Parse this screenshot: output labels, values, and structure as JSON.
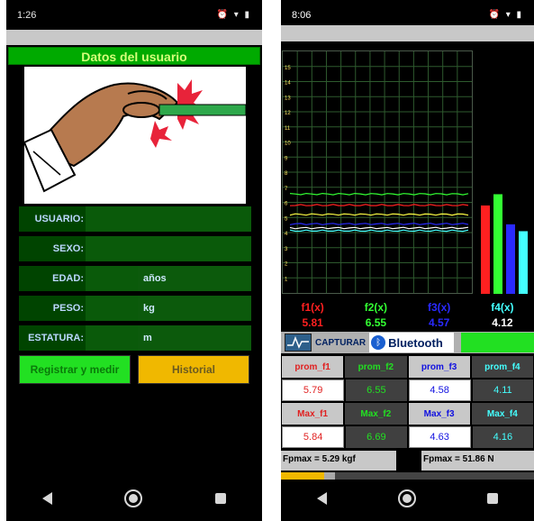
{
  "left": {
    "status_time": "1:26",
    "title": "Datos del usuario",
    "fields": [
      {
        "label": "USUARIO:",
        "value": ""
      },
      {
        "label": "SEXO:",
        "value": ""
      },
      {
        "label": "EDAD:",
        "value": "",
        "unit": "años"
      },
      {
        "label": "PESO:",
        "value": "",
        "unit": "kg"
      },
      {
        "label": "ESTATURA:",
        "value": "",
        "unit": "m"
      }
    ],
    "register_button": "Registrar y medir",
    "history_button": "Historial"
  },
  "right": {
    "status_time": "8:06",
    "graph_ticks": [
      "15",
      "14",
      "13",
      "12",
      "11",
      "10",
      "9",
      "8",
      "7",
      "6",
      "5",
      "4",
      "3",
      "2",
      "1"
    ],
    "series": [
      {
        "name": "f1(x)",
        "value": "5.81",
        "color": "#ff2020"
      },
      {
        "name": "f2(x)",
        "value": "6.55",
        "color": "#33ff33"
      },
      {
        "name": "f3(x)",
        "value": "4.57",
        "color": "#2a2aff"
      },
      {
        "name": "f4(x)",
        "value": "4.12",
        "color": "#44ffff"
      }
    ],
    "extra_traces": [
      {
        "value": 5.2,
        "color": "#ffff44"
      },
      {
        "value": 4.3,
        "color": "#ffffff"
      }
    ],
    "capture_label": "CAPTURAR",
    "bluetooth_label": "Bluetooth",
    "prom_headers": [
      "prom_f1",
      "prom_f2",
      "prom_f3",
      "prom_f4"
    ],
    "prom_values": [
      "5.79",
      "6.55",
      "4.58",
      "4.11"
    ],
    "max_headers": [
      "Max_f1",
      "Max_f2",
      "Max_f3",
      "Max_f4"
    ],
    "max_values": [
      "5.84",
      "6.69",
      "4.63",
      "4.16"
    ],
    "fpmax_kgf": "Fpmax = 5.29 kgf",
    "fpmax_n": "Fpmax = 51.86 N"
  },
  "chart_data": {
    "type": "line",
    "ylim": [
      0,
      16
    ],
    "series": [
      {
        "name": "f1(x)",
        "value": 5.81
      },
      {
        "name": "f2(x)",
        "value": 6.55
      },
      {
        "name": "f3(x)",
        "value": 4.57
      },
      {
        "name": "f4(x)",
        "value": 4.12
      }
    ]
  }
}
